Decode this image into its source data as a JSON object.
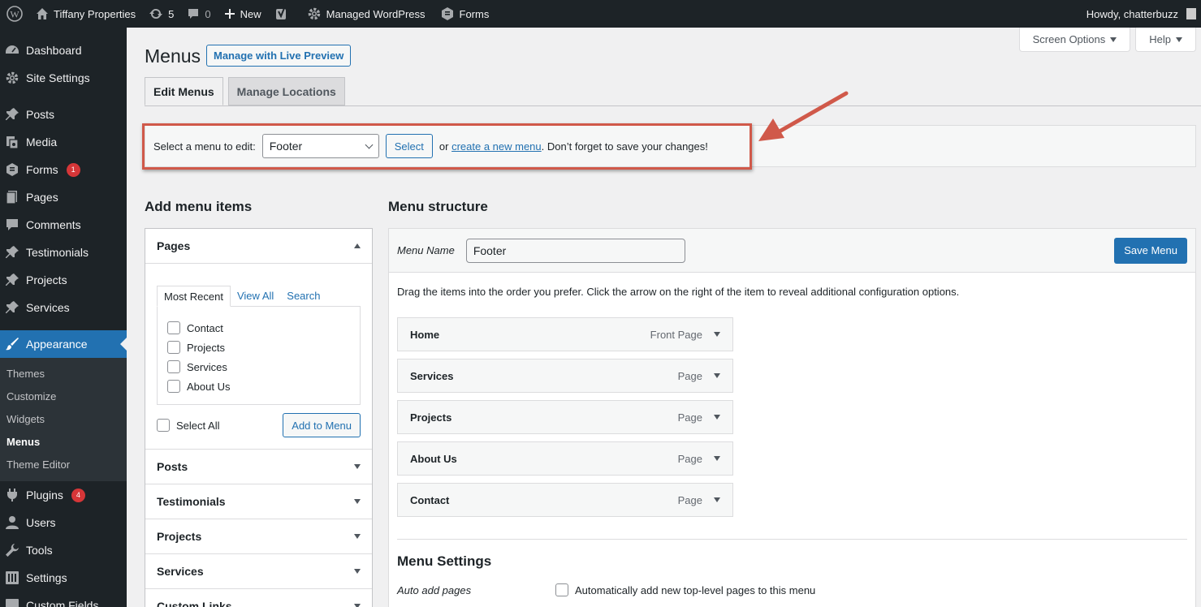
{
  "adminbar": {
    "site_name": "Tiffany Properties",
    "updates_count": "5",
    "comments_count": "0",
    "new_label": "New",
    "managed_label": "Managed WordPress",
    "forms_label": "Forms",
    "howdy": "Howdy, chatterbuzz"
  },
  "sidebar": {
    "dashboard": "Dashboard",
    "site_settings": "Site Settings",
    "posts": "Posts",
    "media": "Media",
    "forms": "Forms",
    "forms_badge": "1",
    "pages": "Pages",
    "comments": "Comments",
    "testimonials": "Testimonials",
    "projects": "Projects",
    "services": "Services",
    "appearance": "Appearance",
    "sub": {
      "themes": "Themes",
      "customize": "Customize",
      "widgets": "Widgets",
      "menus": "Menus",
      "theme_editor": "Theme Editor"
    },
    "plugins": "Plugins",
    "plugins_badge": "4",
    "users": "Users",
    "tools": "Tools",
    "settings": "Settings",
    "custom_fields": "Custom Fields"
  },
  "header": {
    "screen_options": "Screen Options",
    "help": "Help",
    "title": "Menus",
    "live_preview": "Manage with Live Preview",
    "tab_edit": "Edit Menus",
    "tab_locations": "Manage Locations"
  },
  "select_bar": {
    "label": "Select a menu to edit:",
    "selected": "Footer",
    "select_button": "Select",
    "or_text": "or",
    "create_link": "create a new menu",
    "reminder": ". Don’t forget to save your changes!"
  },
  "add_items": {
    "title": "Add menu items",
    "pages_heading": "Pages",
    "tabs": [
      "Most Recent",
      "View All",
      "Search"
    ],
    "pages": [
      "Contact",
      "Projects",
      "Services",
      "About Us"
    ],
    "select_all": "Select All",
    "add_button": "Add to Menu",
    "sections": [
      "Posts",
      "Testimonials",
      "Projects",
      "Services",
      "Custom Links"
    ]
  },
  "structure": {
    "title": "Menu structure",
    "name_label": "Menu Name",
    "name_value": "Footer",
    "save_button": "Save Menu",
    "instructions": "Drag the items into the order you prefer. Click the arrow on the right of the item to reveal additional configuration options.",
    "items": [
      {
        "title": "Home",
        "type": "Front Page"
      },
      {
        "title": "Services",
        "type": "Page"
      },
      {
        "title": "Projects",
        "type": "Page"
      },
      {
        "title": "About Us",
        "type": "Page"
      },
      {
        "title": "Contact",
        "type": "Page"
      }
    ],
    "settings_title": "Menu Settings",
    "auto_add_label": "Auto add pages",
    "auto_add_text": "Automatically add new top-level pages to this menu"
  },
  "colors": {
    "accent": "#2271b1",
    "admin_dark": "#1d2327",
    "highlight": "#d0594a"
  }
}
